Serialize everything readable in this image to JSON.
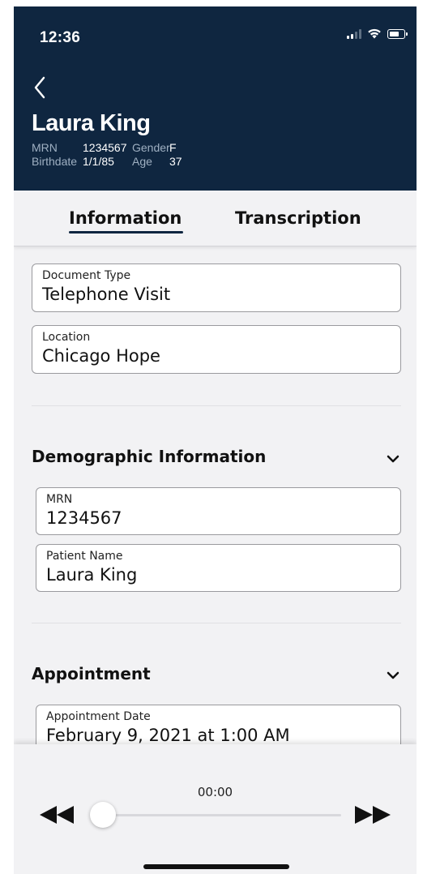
{
  "status_bar": {
    "time": "12:36",
    "icons": [
      "cellular-signal-icon",
      "wifi-icon",
      "battery-icon"
    ]
  },
  "header": {
    "back_icon": "chevron-left-icon",
    "patient_name": "Laura King",
    "mrn_label": "MRN",
    "mrn_value": "1234567",
    "gender_label": "Gender",
    "gender_value": "F",
    "birthdate_label": "Birthdate",
    "birthdate_value": "1/1/85",
    "age_label": "Age",
    "age_value": "37"
  },
  "tabs": [
    {
      "label": "Information",
      "active": true
    },
    {
      "label": "Transcription",
      "active": false
    }
  ],
  "fields": {
    "document_type": {
      "label": "Document Type",
      "value": "Telephone Visit"
    },
    "location": {
      "label": "Location",
      "value": "Chicago Hope"
    }
  },
  "sections": {
    "demographic": {
      "title": "Demographic Information",
      "chevron_icon": "chevron-down-icon",
      "fields": {
        "mrn": {
          "label": "MRN",
          "value": "1234567"
        },
        "patient_name": {
          "label": "Patient Name",
          "value": "Laura King"
        }
      }
    },
    "appointment": {
      "title": "Appointment",
      "chevron_icon": "chevron-down-icon",
      "fields": {
        "appointment_date": {
          "label": "Appointment Date",
          "value": "February 9, 2021 at 1:00 AM"
        }
      }
    }
  },
  "player": {
    "time": "00:00",
    "progress": 0,
    "rewind_icon": "rewind-icon",
    "forward_icon": "fast-forward-icon"
  },
  "colors": {
    "header_bg": "#0f2640",
    "page_bg": "#f2f2f4",
    "accent": "#0f2640"
  }
}
